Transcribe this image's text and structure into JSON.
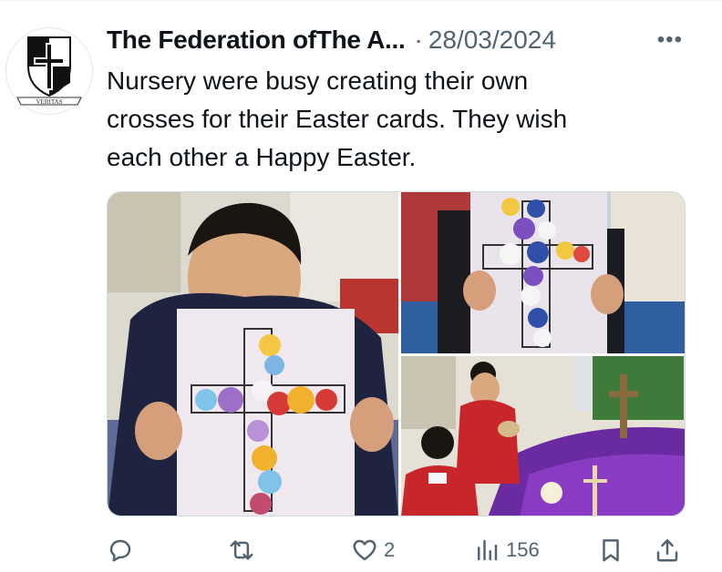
{
  "tweet": {
    "author_name": "The Federation ofThe A...",
    "separator": "·",
    "date": "28/03/2024",
    "more_label": "•••",
    "text": "Nursery were busy creating their own\ncrosses for their Easter cards. They wish\neach other a Happy Easter.",
    "avatar": {
      "motto": "VERITAS",
      "icon": "school-crest-icon"
    }
  },
  "media": {
    "photos": [
      {
        "id": "boy-holding-cross-card"
      },
      {
        "id": "hands-holding-cross-card"
      },
      {
        "id": "children-at-easter-table"
      }
    ]
  },
  "actions": {
    "reply": {
      "icon": "reply-icon",
      "count": ""
    },
    "retweet": {
      "icon": "retweet-icon",
      "count": ""
    },
    "like": {
      "icon": "heart-icon",
      "count": "2"
    },
    "views": {
      "icon": "views-chart-icon",
      "count": "156"
    },
    "bookmark": {
      "icon": "bookmark-icon"
    },
    "share": {
      "icon": "share-icon"
    }
  },
  "colors": {
    "text_primary": "#0f1419",
    "text_secondary": "#536471",
    "border": "#cfd9de"
  }
}
